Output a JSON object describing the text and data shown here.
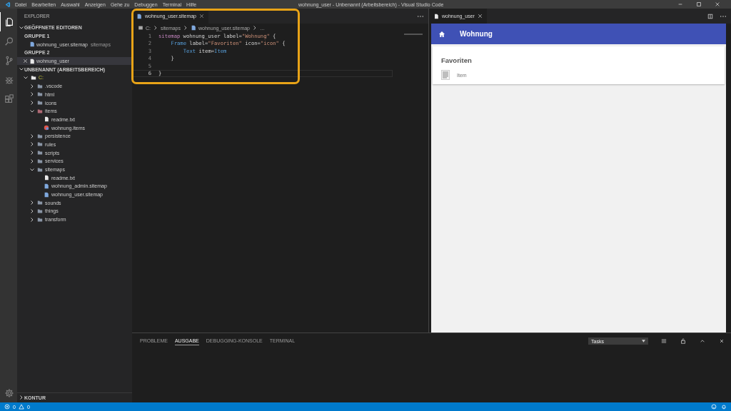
{
  "title_bar": {
    "menu": [
      "Datei",
      "Bearbeiten",
      "Auswahl",
      "Anzeigen",
      "Gehe zu",
      "Debuggen",
      "Terminal",
      "Hilfe"
    ],
    "title": "wohnung_user - Unbenannt (Arbeitsbereich) - Visual Studio Code"
  },
  "activity_bar": [
    {
      "kind": "files",
      "selected": true
    },
    {
      "kind": "search",
      "selected": false
    },
    {
      "kind": "source-control",
      "selected": false
    },
    {
      "kind": "debug",
      "selected": false
    },
    {
      "kind": "extensions",
      "selected": false
    }
  ],
  "sidebar": {
    "title": "EXPLORER",
    "open_editors": {
      "label": "GEÖFFNETE EDITOREN",
      "expanded": true,
      "groups": [
        {
          "label": "GRUPPE 1",
          "files": [
            {
              "name": "wohnung_user.sitemap",
              "path": "sitemaps",
              "selected": false
            }
          ]
        },
        {
          "label": "GRUPPE 2",
          "files": [
            {
              "name": "wohnung_user",
              "selected": true
            }
          ]
        }
      ]
    },
    "workspace": {
      "label": "UNBENANNT (ARBEITSBEREICH)",
      "expanded": true,
      "tree": [
        {
          "name": "C:",
          "kind": "root",
          "expanded": true,
          "children": [
            {
              "name": ".vscode",
              "kind": "folder",
              "expanded": false
            },
            {
              "name": "html",
              "kind": "folder",
              "expanded": false
            },
            {
              "name": "icons",
              "kind": "folder",
              "expanded": false
            },
            {
              "name": "items",
              "kind": "items-folder",
              "expanded": true,
              "children": [
                {
                  "name": "readme.txt",
                  "kind": "file"
                },
                {
                  "name": "wohnung.items",
                  "kind": "items-file"
                }
              ]
            },
            {
              "name": "persistence",
              "kind": "folder",
              "expanded": false
            },
            {
              "name": "rules",
              "kind": "folder",
              "expanded": false
            },
            {
              "name": "scripts",
              "kind": "folder",
              "expanded": false
            },
            {
              "name": "services",
              "kind": "folder",
              "expanded": false
            },
            {
              "name": "sitemaps",
              "kind": "folder",
              "expanded": true,
              "children": [
                {
                  "name": "readme.txt",
                  "kind": "file"
                },
                {
                  "name": "wohnung_admin.sitemap",
                  "kind": "sitemap-file"
                },
                {
                  "name": "wohnung_user.sitemap",
                  "kind": "sitemap-file"
                }
              ]
            },
            {
              "name": "sounds",
              "kind": "folder",
              "expanded": false
            },
            {
              "name": "things",
              "kind": "folder",
              "expanded": false
            },
            {
              "name": "transform",
              "kind": "folder",
              "expanded": false
            }
          ]
        }
      ]
    },
    "outline": {
      "label": "KONTUR",
      "expanded": false
    }
  },
  "editor": {
    "highlighted": true,
    "tab": {
      "name": "wohnung_user.sitemap",
      "selected": true
    },
    "breadcrumb": [
      "C:",
      "sitemaps",
      "wohnung_user.sitemap",
      "…"
    ],
    "lines": [
      {
        "number": "1",
        "active": false,
        "tokens": [
          {
            "kind": "keyword",
            "text": "sitemap"
          },
          {
            "kind": "plain",
            "text": " wohnung_user label="
          },
          {
            "kind": "string",
            "text": "\"Wohnung\""
          },
          {
            "kind": "plain",
            "text": " {"
          }
        ]
      },
      {
        "number": "2",
        "active": false,
        "tokens": [
          {
            "kind": "type",
            "text": "Frame"
          },
          {
            "kind": "plain",
            "text": " label="
          },
          {
            "kind": "string",
            "text": "\"Favoriten\""
          },
          {
            "kind": "plain",
            "text": " icon="
          },
          {
            "kind": "string",
            "text": "\"icon\""
          },
          {
            "kind": "plain",
            "text": " {"
          }
        ]
      },
      {
        "number": "3",
        "active": false,
        "tokens": [
          {
            "kind": "type",
            "text": "Text"
          },
          {
            "kind": "plain",
            "text": " item="
          },
          {
            "kind": "type",
            "text": "Item"
          }
        ]
      },
      {
        "number": "4",
        "active": false,
        "tokens": [
          {
            "kind": "plain",
            "text": "}"
          }
        ]
      },
      {
        "number": "5",
        "active": false
      },
      {
        "number": "6",
        "active": true,
        "tokens": [
          {
            "kind": "plain",
            "text": "}"
          }
        ]
      }
    ]
  },
  "preview": {
    "tab": {
      "name": "wohnung_user",
      "selected": true
    },
    "header": {
      "title": "Wohnung"
    },
    "card": {
      "title": "Favoriten",
      "items": [
        {
          "label": "Item"
        }
      ]
    }
  },
  "panel": {
    "tabs": [
      {
        "label": "PROBLEME",
        "selected": false
      },
      {
        "label": "AUSGABE",
        "selected": true
      },
      {
        "label": "DEBUGGING-KONSOLE",
        "selected": false
      },
      {
        "label": "TERMINAL",
        "selected": false
      }
    ],
    "select": {
      "value": "Tasks"
    }
  },
  "status_bar": {
    "errors": "0",
    "warnings": "0"
  }
}
